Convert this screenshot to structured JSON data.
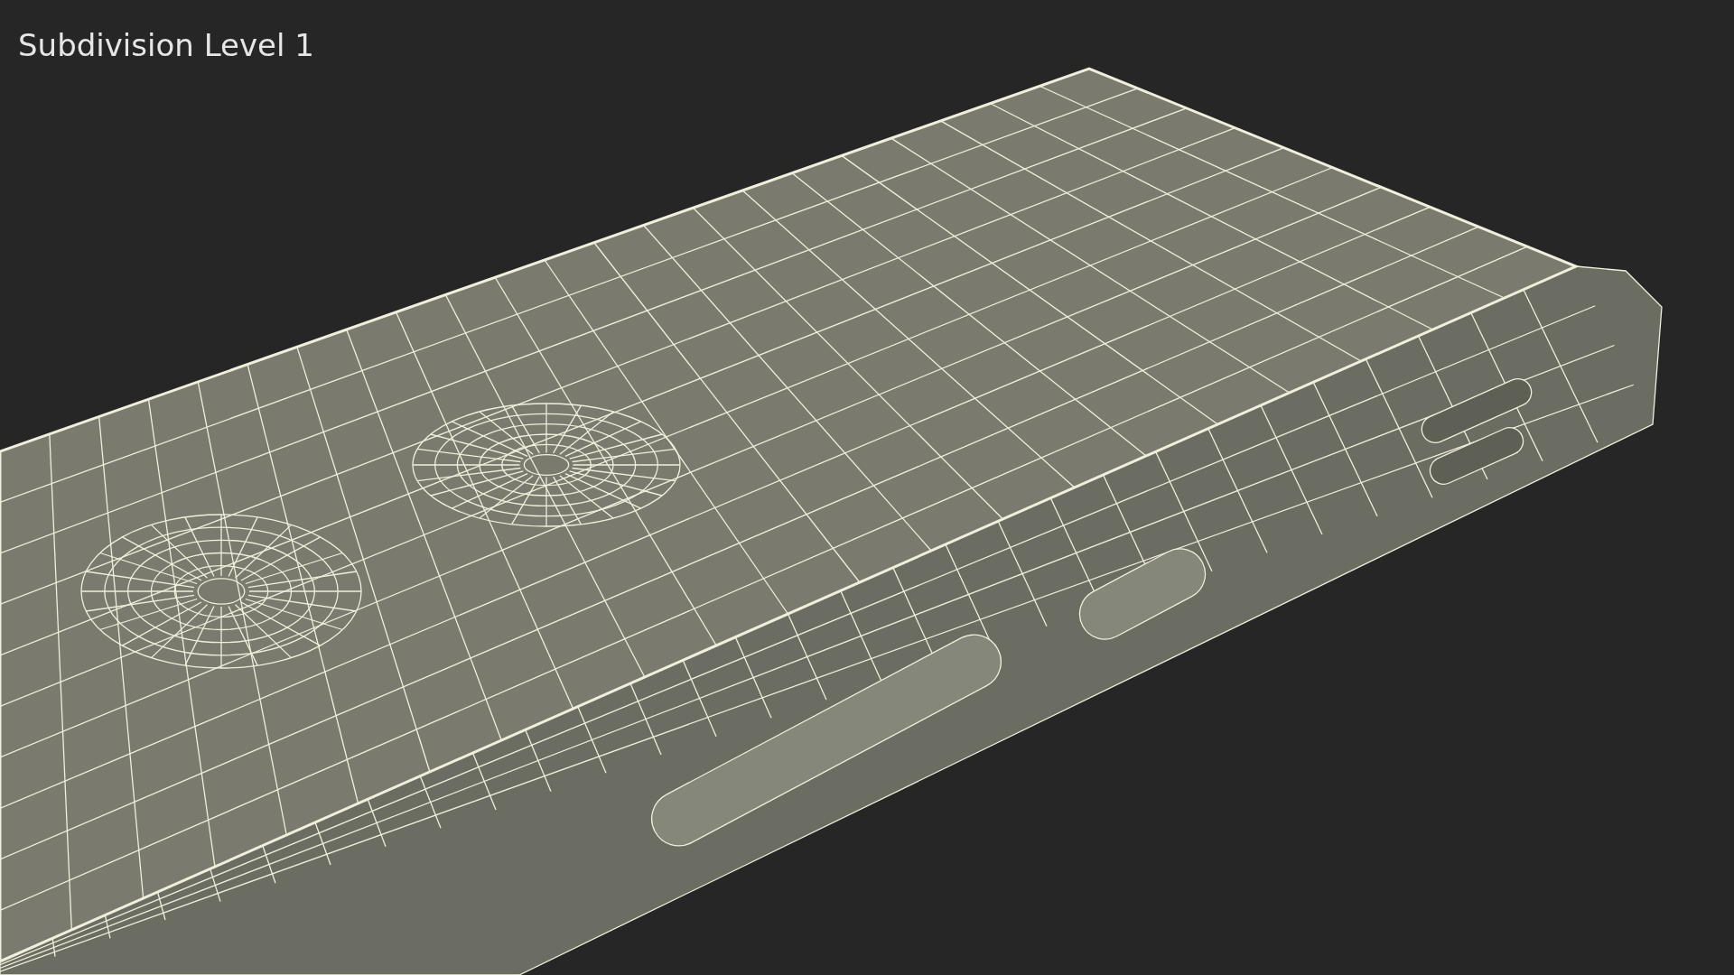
{
  "label": "Subdivision Level 1"
}
